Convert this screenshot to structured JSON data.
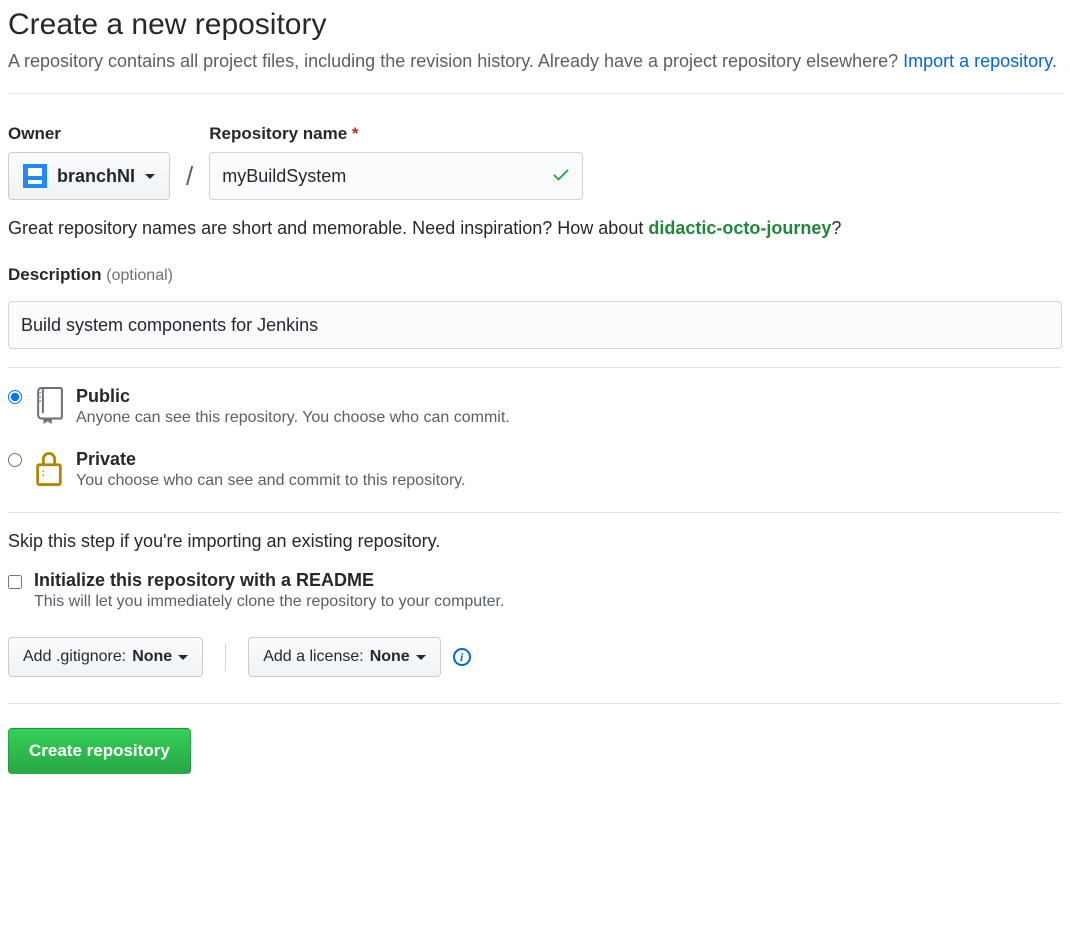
{
  "header": {
    "title": "Create a new repository",
    "subtitle_prefix": "A repository contains all project files, including the revision history. Already have a project repository elsewhere? ",
    "import_link": "Import a repository."
  },
  "owner": {
    "label": "Owner",
    "value": "branchNI"
  },
  "repo_name": {
    "label": "Repository name",
    "required_mark": "*",
    "value": "myBuildSystem"
  },
  "name_hint": {
    "prefix": "Great repository names are short and memorable. Need inspiration? How about ",
    "suggestion": "didactic-octo-journey",
    "suffix": "?"
  },
  "description": {
    "label": "Description",
    "optional": "(optional)",
    "value": "Build system components for Jenkins"
  },
  "visibility": {
    "public": {
      "title": "Public",
      "sub": "Anyone can see this repository. You choose who can commit."
    },
    "private": {
      "title": "Private",
      "sub": "You choose who can see and commit to this repository."
    }
  },
  "skip_text": "Skip this step if you're importing an existing repository.",
  "readme": {
    "title": "Initialize this repository with a README",
    "sub": "This will let you immediately clone the repository to your computer."
  },
  "gitignore": {
    "label": "Add .gitignore: ",
    "value": "None"
  },
  "license": {
    "label": "Add a license: ",
    "value": "None"
  },
  "submit": "Create repository"
}
